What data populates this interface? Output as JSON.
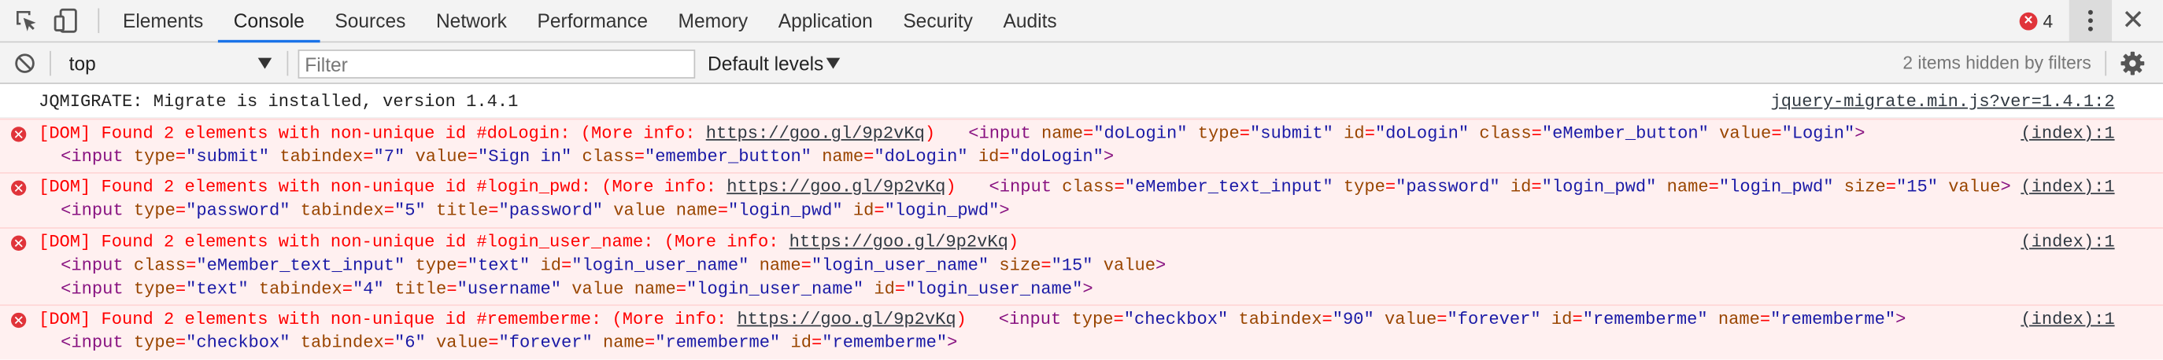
{
  "tabbar": {
    "tabs": [
      "Elements",
      "Console",
      "Sources",
      "Network",
      "Performance",
      "Memory",
      "Application",
      "Security",
      "Audits"
    ],
    "active_tab": "Console",
    "error_count": "4"
  },
  "toolbar": {
    "context_value": "top",
    "filter_placeholder": "Filter",
    "levels_label": "Default levels",
    "hidden_note": "2 items hidden by filters"
  },
  "messages": {
    "info": {
      "text": "JQMIGRATE: Migrate is installed, version 1.4.1",
      "source": "jquery-migrate.min.js?ver=1.4.1:2"
    },
    "errors": [
      {
        "text": "[DOM] Found 2 elements with non-unique id #doLogin: (More info: ",
        "url": "https://goo.gl/9p2vKq",
        "text_after": ")",
        "source": "(index):1",
        "first_el": "<input name=\"doLogin\" type=\"submit\" id=\"doLogin\" class=\"eMember_button\" value=\"Login\">",
        "second_el": "<input type=\"submit\" tabindex=\"7\" value=\"Sign in\" class=\"emember_button\" name=\"doLogin\" id=\"doLogin\">"
      },
      {
        "text": "[DOM] Found 2 elements with non-unique id #login_pwd: (More info: ",
        "url": "https://goo.gl/9p2vKq",
        "text_after": ")",
        "source": "(index):1",
        "first_el": "<input class=\"eMember_text_input\" type=\"password\" id=\"login_pwd\" name=\"login_pwd\" size=\"15\" value>",
        "second_el": "<input type=\"password\" tabindex=\"5\" title=\"password\" value name=\"login_pwd\" id=\"login_pwd\">"
      },
      {
        "text": "[DOM] Found 2 elements with non-unique id #login_user_name: (More info: ",
        "url": "https://goo.gl/9p2vKq",
        "text_after": ")",
        "source": "(index):1",
        "first_el": "<input class=\"eMember_text_input\" type=\"text\" id=\"login_user_name\" name=\"login_user_name\" size=\"15\" value>",
        "second_el": "<input type=\"text\" tabindex=\"4\" title=\"username\" value name=\"login_user_name\" id=\"login_user_name\">"
      },
      {
        "text": "[DOM] Found 2 elements with non-unique id #rememberme: (More info: ",
        "url": "https://goo.gl/9p2vKq",
        "text_after": ")",
        "source": "(index):1",
        "first_el": "<input type=\"checkbox\" tabindex=\"90\" value=\"forever\" id=\"rememberme\" name=\"rememberme\">",
        "second_el": "<input type=\"checkbox\" tabindex=\"6\" value=\"forever\" name=\"rememberme\" id=\"rememberme\">"
      }
    ]
  },
  "icons": {
    "inspect": "inspect-element-icon",
    "device": "device-toolbar-icon",
    "clear": "clear-console-icon",
    "error": "error-icon",
    "kebab": "more-options-icon",
    "close": "close-icon",
    "settings": "gear-icon"
  },
  "colors": {
    "active_tab_underline": "#1a73e8",
    "error_text": "#ff0000",
    "error_background": "#fff0f0",
    "error_icon": "#e0343a"
  }
}
